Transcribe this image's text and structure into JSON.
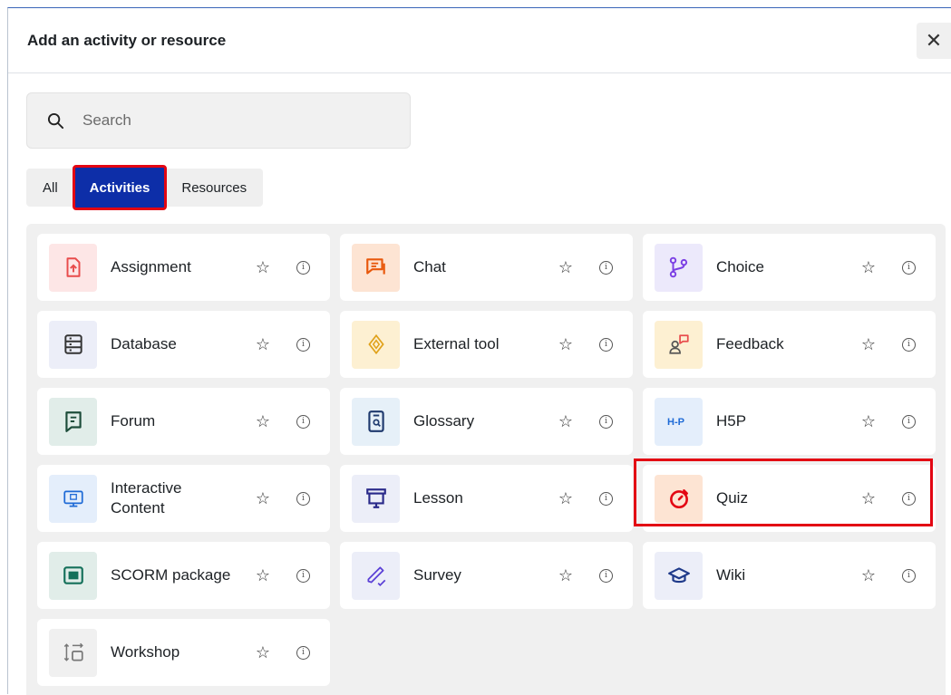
{
  "modal": {
    "title": "Add an activity or resource",
    "close_glyph": "✕"
  },
  "search": {
    "placeholder": "Search",
    "value": ""
  },
  "tabs": [
    {
      "label": "All",
      "active": false
    },
    {
      "label": "Activities",
      "active": true
    },
    {
      "label": "Resources",
      "active": false
    }
  ],
  "items": [
    {
      "label": "Assignment",
      "icon": "assignment-icon",
      "color": "#e84c4c"
    },
    {
      "label": "Chat",
      "icon": "chat-icon",
      "color": "#e8580c"
    },
    {
      "label": "Choice",
      "icon": "choice-icon",
      "color": "#7b3fe4"
    },
    {
      "label": "Database",
      "icon": "database-icon",
      "color": "#333333"
    },
    {
      "label": "External tool",
      "icon": "external-tool-icon",
      "color": "#e0a21b"
    },
    {
      "label": "Feedback",
      "icon": "feedback-icon",
      "color": "#e84c4c"
    },
    {
      "label": "Forum",
      "icon": "forum-icon",
      "color": "#1d4d3a"
    },
    {
      "label": "Glossary",
      "icon": "glossary-icon",
      "color": "#1f3a6e"
    },
    {
      "label": "H5P",
      "icon": "h5p-icon",
      "color": "#1e6ad6"
    },
    {
      "label": "Interactive Content",
      "icon": "interactive-content-icon",
      "color": "#1e6ad6"
    },
    {
      "label": "Lesson",
      "icon": "lesson-icon",
      "color": "#2a2a8a"
    },
    {
      "label": "Quiz",
      "icon": "quiz-icon",
      "color": "#e30613"
    },
    {
      "label": "SCORM package",
      "icon": "scorm-icon",
      "color": "#14705a"
    },
    {
      "label": "Survey",
      "icon": "survey-icon",
      "color": "#5a3fd6"
    },
    {
      "label": "Wiki",
      "icon": "wiki-icon",
      "color": "#1f3a8a"
    },
    {
      "label": "Workshop",
      "icon": "workshop-icon",
      "color": "#777777"
    }
  ],
  "highlighted_item": "Quiz",
  "star_glyph": "☆",
  "info_glyph": "i"
}
